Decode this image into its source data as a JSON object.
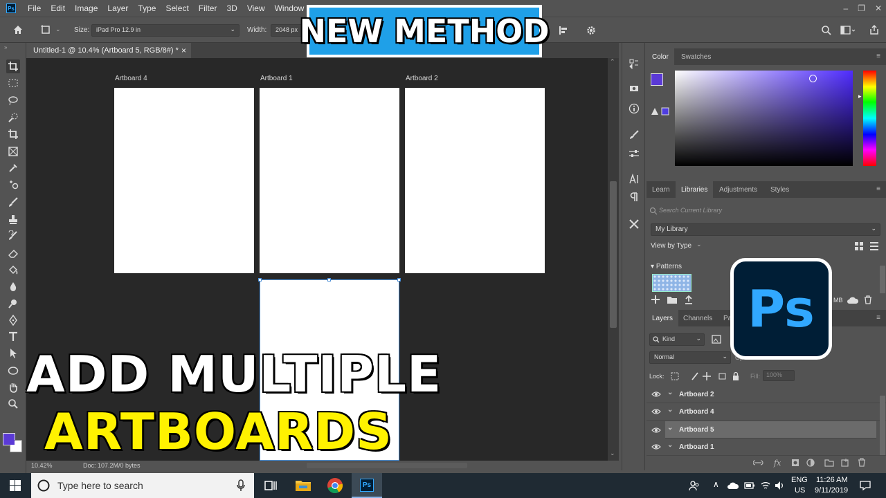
{
  "app": {
    "logo_text": "Ps"
  },
  "menubar": {
    "items": [
      "File",
      "Edit",
      "Image",
      "Layer",
      "Type",
      "Select",
      "Filter",
      "3D",
      "View",
      "Window",
      "He"
    ],
    "window_controls": [
      "–",
      "❐",
      "✕"
    ]
  },
  "options_bar": {
    "size_label": "Size:",
    "size_value": "iPad Pro 12.9 in",
    "width_label": "Width:",
    "width_value": "2048 px"
  },
  "document": {
    "tab_title": "Untitled-1 @ 10.4% (Artboard 5, RGB/8#) *",
    "tab_close": "×",
    "zoom": "10.42%",
    "doc_info": "Doc: 107.2M/0 bytes"
  },
  "artboards": [
    {
      "label": "Artboard 4"
    },
    {
      "label": "Artboard 1"
    },
    {
      "label": "Artboard 2"
    },
    {
      "label": "Artboard 5"
    }
  ],
  "color_panel": {
    "tabs": [
      "Color",
      "Swatches"
    ],
    "foreground_color": "#5b3ad6",
    "hue_color": "#4f2cff"
  },
  "libraries_panel": {
    "tabs": [
      "Learn",
      "Libraries",
      "Adjustments",
      "Styles"
    ],
    "search_placeholder": "Search Current Library",
    "library_name": "My Library",
    "view_by": "View by Type",
    "section": "Patterns",
    "size_text": "MB"
  },
  "layers_panel": {
    "tabs": [
      "Layers",
      "Channels",
      "Pa"
    ],
    "filter_kind": "Kind",
    "blend_mode": "Normal",
    "opacity_label": "Op",
    "lock_label": "Lock:",
    "fill_label": "Fill:",
    "fill_value": "100%",
    "layers": [
      {
        "name": "Artboard 2",
        "selected": false
      },
      {
        "name": "Artboard 4",
        "selected": false
      },
      {
        "name": "Artboard 5",
        "selected": true
      },
      {
        "name": "Artboard 1",
        "selected": false
      }
    ]
  },
  "overlay": {
    "badge": "NEW METHOD",
    "title_line1": "ADD MULTIPLE",
    "title_line2": "ARTBOARDS",
    "logo": "Ps"
  },
  "taskbar": {
    "search_placeholder": "Type here to search",
    "lang_top": "ENG",
    "lang_bottom": "US",
    "time": "11:26 AM",
    "date": "9/11/2019"
  }
}
